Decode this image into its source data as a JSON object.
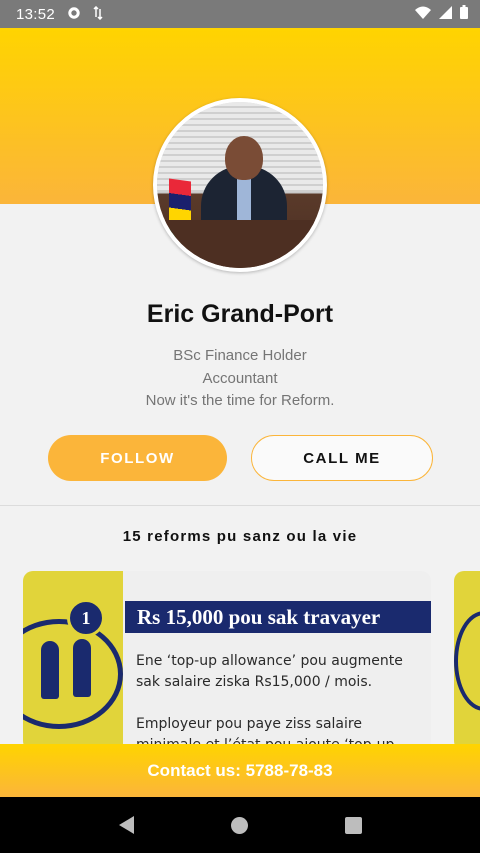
{
  "status_bar": {
    "time": "13:52",
    "left_icons": [
      "gear-icon",
      "data-sync-icon"
    ],
    "right_icons": [
      "wifi-icon",
      "signal-icon",
      "battery-icon"
    ]
  },
  "profile": {
    "name": "Eric Grand-Port",
    "bio_lines": [
      "BSc Finance Holder",
      "Accountant",
      "Now it's the time for Reform."
    ]
  },
  "actions": {
    "follow_label": "FOLLOW",
    "call_label": "CALL ME"
  },
  "section": {
    "title": "15 reforms pu sanz ou la vie"
  },
  "reform_card": {
    "number": "1",
    "heading": "Rs 15,000 pou sak travayer",
    "paragraphs": [
      "Ene ‘top-up allowance’ pou augmente sak salaire ziska Rs15,000 / mois.",
      "Employeur pou paye ziss salaire minimale et l’état pou ajoute ‘top-up allowance’"
    ]
  },
  "contact": {
    "label": "Contact us: 5788-78-83"
  },
  "nav": {
    "icons": [
      "back-icon",
      "home-icon",
      "recents-icon"
    ]
  },
  "colors": {
    "accent": "#fbb53a",
    "hero_top": "#ffd400",
    "card_navy": "#1a2a6e",
    "card_yellow": "#e1d43a"
  }
}
